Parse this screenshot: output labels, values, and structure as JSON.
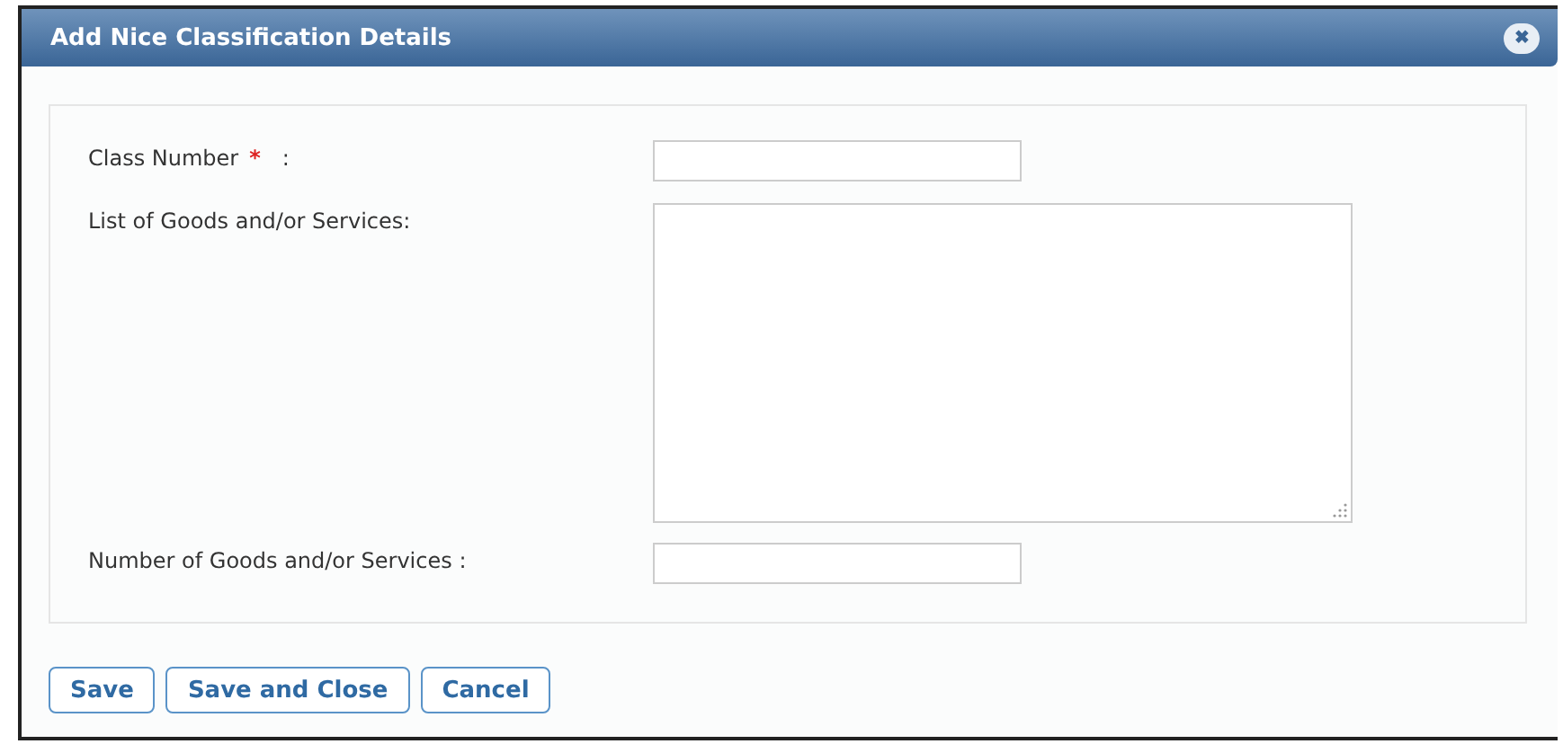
{
  "dialog": {
    "title": "Add Nice Classification Details",
    "close_icon": "✖"
  },
  "fields": [
    {
      "kind": "input",
      "label": "Class Number",
      "required_mark": "*",
      "suffix": ":"
    },
    {
      "kind": "textarea",
      "label": "List of Goods and/or Services:"
    },
    {
      "kind": "input",
      "label": "Number of Goods and/or Services :"
    }
  ],
  "buttons": [
    "Save",
    "Save and Close",
    "Cancel"
  ]
}
